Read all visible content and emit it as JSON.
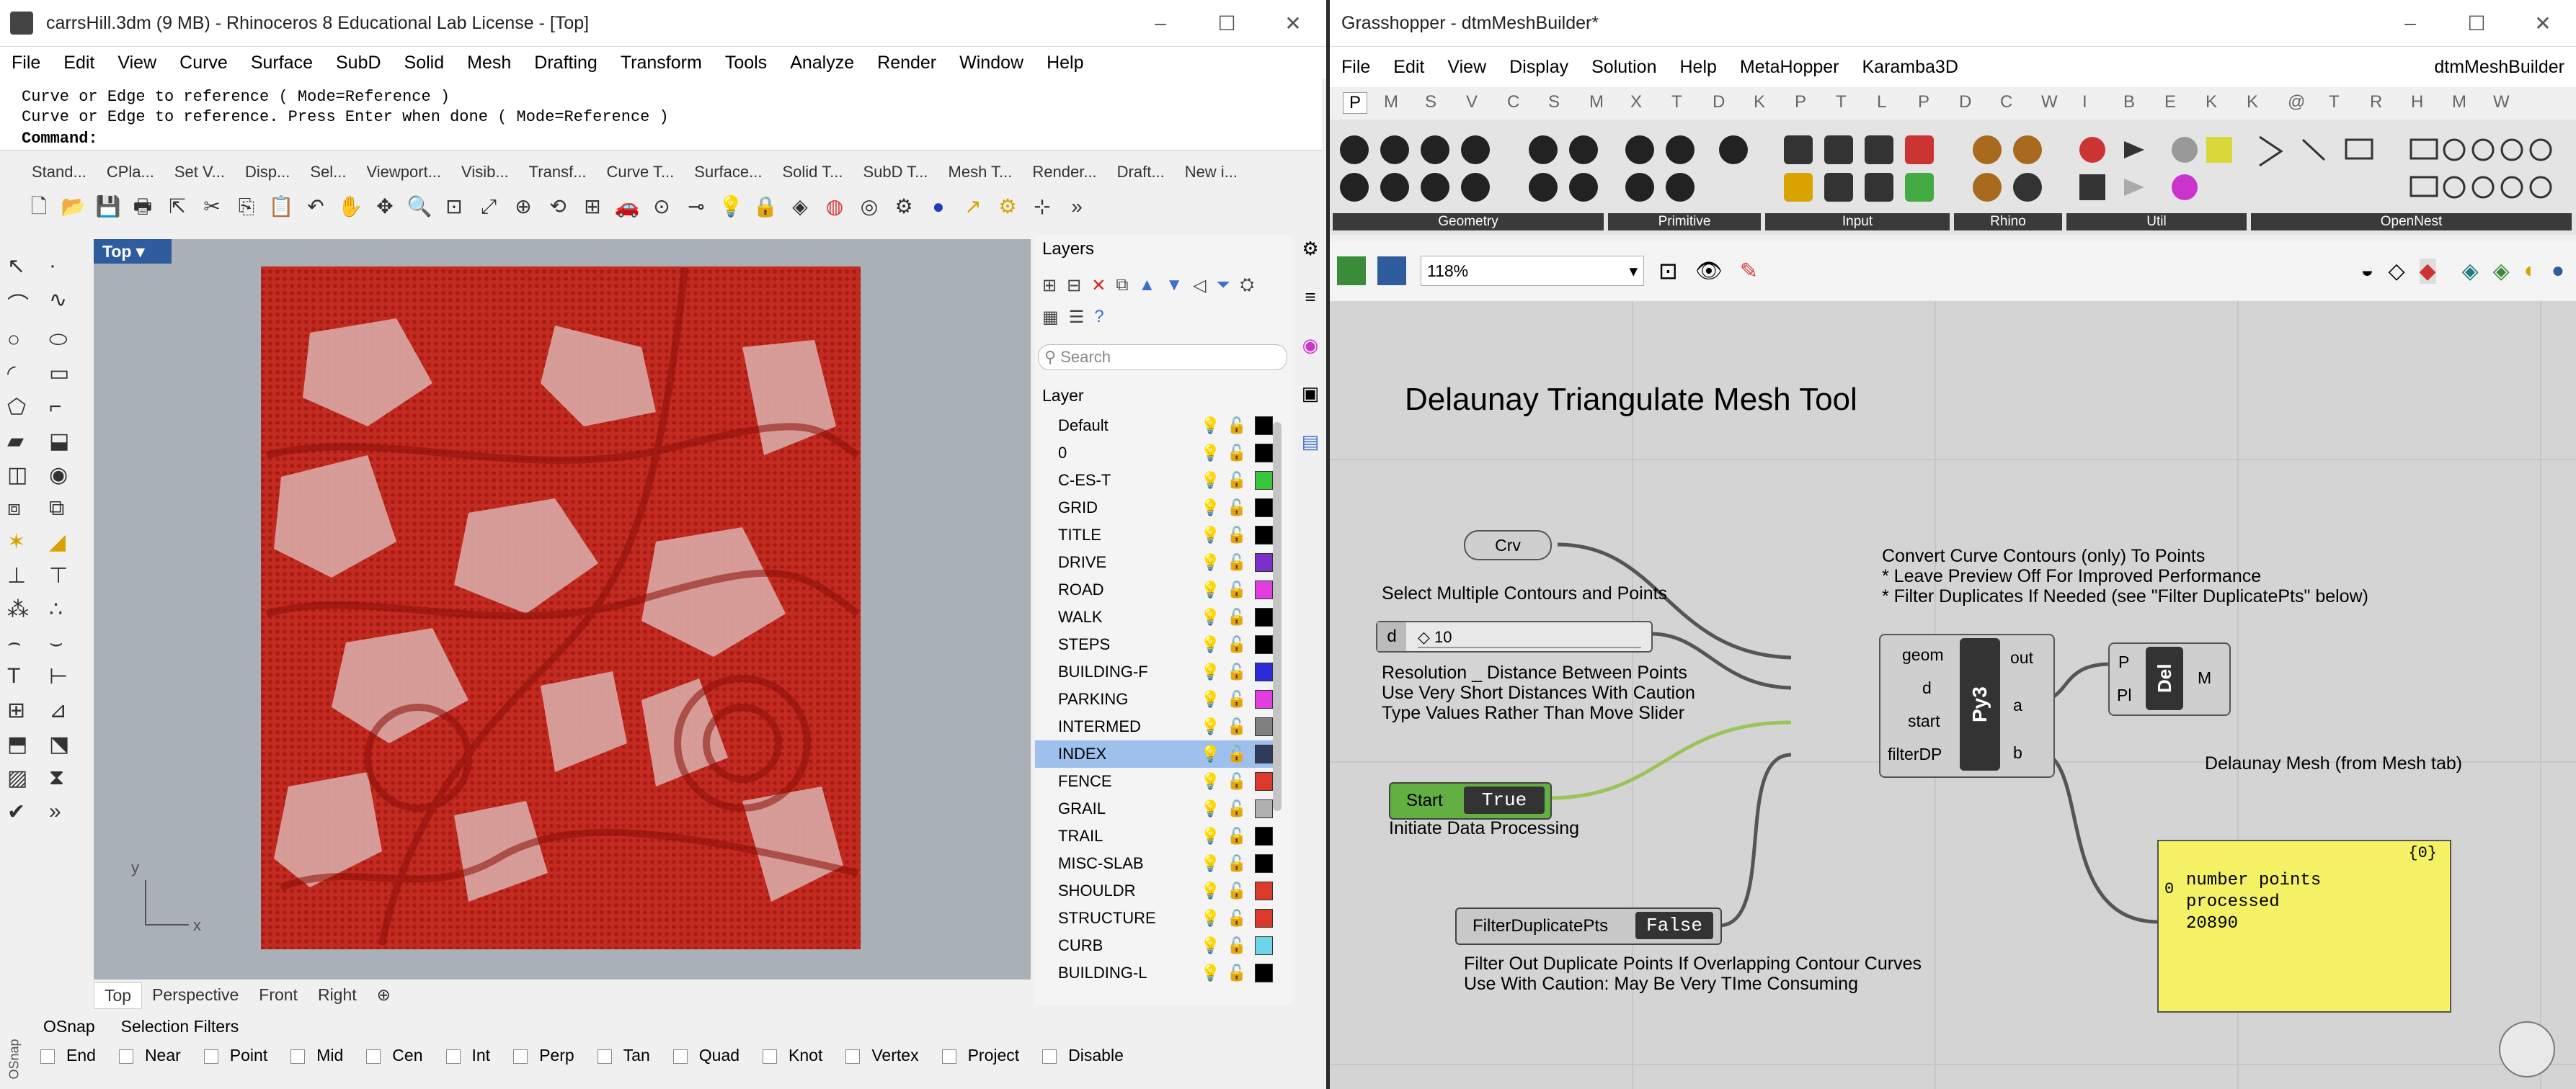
{
  "rhino": {
    "title": "carrsHill.3dm (9 MB) - Rhinoceros 8 Educational Lab License - [Top]",
    "menu": [
      "File",
      "Edit",
      "View",
      "Curve",
      "Surface",
      "SubD",
      "Solid",
      "Mesh",
      "Drafting",
      "Transform",
      "Tools",
      "Analyze",
      "Render",
      "Window",
      "Help"
    ],
    "history": [
      "Curve or Edge to reference ( Mode=Reference )",
      "Curve or Edge to reference. Press Enter when done ( Mode=Reference )"
    ],
    "command_label": "Command:",
    "toolbar_tabs": [
      "Stand...",
      "CPla...",
      "Set V...",
      "Disp...",
      "Sel...",
      "Viewport...",
      "Visib...",
      "Transf...",
      "Curve T...",
      "Surface...",
      "Solid T...",
      "SubD T...",
      "Mesh T...",
      "Render...",
      "Draft...",
      "New i..."
    ],
    "viewport_label": "Top",
    "viewport_tabs": [
      "Top",
      "Perspective",
      "Front",
      "Right"
    ],
    "axis_x": "x",
    "axis_y": "y",
    "layers_title": "Layers",
    "search_placeholder": "Search",
    "layer_header": "Layer",
    "layers": [
      {
        "name": "Default",
        "color": "#000000",
        "bulb": "on"
      },
      {
        "name": "0",
        "color": "#000000"
      },
      {
        "name": "C-ES-T",
        "color": "#3cc63c"
      },
      {
        "name": "GRID",
        "color": "#000000"
      },
      {
        "name": "TITLE",
        "color": "#000000"
      },
      {
        "name": "DRIVE",
        "color": "#7b2fc9"
      },
      {
        "name": "ROAD",
        "color": "#e03ee0"
      },
      {
        "name": "WALK",
        "color": "#000000"
      },
      {
        "name": "STEPS",
        "color": "#000000"
      },
      {
        "name": "BUILDING-F",
        "color": "#2b2bd9"
      },
      {
        "name": "PARKING",
        "color": "#e03ee0"
      },
      {
        "name": "INTERMED",
        "color": "#808080"
      },
      {
        "name": "INDEX",
        "color": "#2f3b5a",
        "selected": true
      },
      {
        "name": "FENCE",
        "color": "#d93a2b"
      },
      {
        "name": "GRAIL",
        "color": "#b0b0b0"
      },
      {
        "name": "TRAIL",
        "color": "#000000"
      },
      {
        "name": "MISC-SLAB",
        "color": "#000000"
      },
      {
        "name": "SHOULDR",
        "color": "#d93a2b"
      },
      {
        "name": "STRUCTURE",
        "color": "#d93a2b"
      },
      {
        "name": "CURB",
        "color": "#6fd6e8"
      },
      {
        "name": "BUILDING-L",
        "color": "#000000"
      }
    ],
    "status_tabs": [
      "OSnap",
      "Selection Filters"
    ],
    "osnap_side": "OSnap",
    "osnaps": [
      "End",
      "Near",
      "Point",
      "Mid",
      "Cen",
      "Int",
      "Perp",
      "Tan",
      "Quad",
      "Knot",
      "Vertex",
      "Project",
      "Disable"
    ]
  },
  "gh": {
    "title": "Grasshopper - dtmMeshBuilder*",
    "doc_name": "dtmMeshBuilder",
    "menu": [
      "File",
      "Edit",
      "View",
      "Display",
      "Solution",
      "Help",
      "MetaHopper",
      "Karamba3D"
    ],
    "tabs": [
      "P",
      "M",
      "S",
      "V",
      "C",
      "S",
      "M",
      "X",
      "T",
      "D",
      "K",
      "P",
      "T",
      "L",
      "P",
      "D",
      "C",
      "W",
      "I",
      "B",
      "E",
      "K",
      "K",
      "@",
      "T",
      "R",
      "H",
      "M",
      "W"
    ],
    "categories": [
      "Geometry",
      "Primitive",
      "Input",
      "Rhino",
      "Util",
      "OpenNest"
    ],
    "zoom": "118%",
    "canvas_title": "Delaunay Triangulate Mesh Tool",
    "crv_param": "Crv",
    "select_label": "Select Multiple Contours and Points",
    "slider_name": "d",
    "slider_value": "◇ 10",
    "resolution_notes": [
      "Resolution _ Distance Between Points",
      "Use Very Short Distances With Caution",
      "Type Values Rather Than Move Slider"
    ],
    "start_toggle": {
      "name": "Start",
      "value": "True"
    },
    "start_label": "Initiate Data Processing",
    "filter_toggle": {
      "name": "FilterDuplicatePts",
      "value": "False"
    },
    "filter_notes": [
      "Filter Out Duplicate Points If Overlapping Contour Curves",
      "Use With Caution: May Be Very TIme Consuming"
    ],
    "convert_notes": [
      "Convert Curve Contours (only)  To Points",
      "* Leave Preview Off For Improved Performance",
      "* Filter Duplicates If Needed (see \"Filter DuplicatePts\" below)"
    ],
    "py_inputs": [
      "geom",
      "d",
      "start",
      "filterDP"
    ],
    "py_outputs": [
      "out",
      "a",
      "b"
    ],
    "py_label": "Py3",
    "del_inputs": [
      "P",
      "Pl"
    ],
    "del_label": "Del",
    "del_output": "M",
    "del_caption": "Delaunay Mesh (from Mesh tab)",
    "panel_path": "{0}",
    "panel_index": "0",
    "panel_text": "number points processed 20890"
  }
}
